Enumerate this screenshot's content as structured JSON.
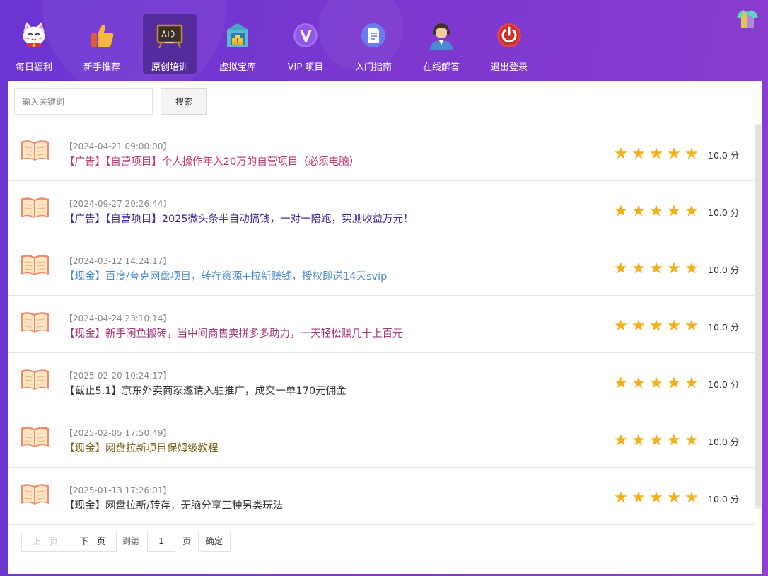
{
  "nav": {
    "items": [
      {
        "label": "每日福利",
        "icon": "lucky-cat-icon",
        "active": false
      },
      {
        "label": "新手推荐",
        "icon": "thumbs-up-icon",
        "active": false
      },
      {
        "label": "原创培训",
        "icon": "blackboard-icon",
        "active": true
      },
      {
        "label": "虚拟宝库",
        "icon": "vault-icon",
        "active": false
      },
      {
        "label": "VIP 项目",
        "icon": "vip-icon",
        "active": false
      },
      {
        "label": "入门指南",
        "icon": "document-icon",
        "active": false
      },
      {
        "label": "在线解答",
        "icon": "support-agent-icon",
        "active": false
      },
      {
        "label": "退出登录",
        "icon": "power-icon",
        "active": false
      }
    ],
    "skin_icon": "tshirt-icon"
  },
  "search": {
    "placeholder": "输入关键词",
    "value": "",
    "button_label": "搜索"
  },
  "items": [
    {
      "date": "【2024-04-21 09:00:00】",
      "title": "【广告】【自营项目】个人操作年入20万的自营项目（必须电脑）",
      "color": "#c0396f",
      "rating": 5,
      "score": "10.0 分"
    },
    {
      "date": "【2024-09-27 20:26:44】",
      "title": "【广告】【自营项目】2025微头条半自动搞钱，一对一陪跑，实测收益万元！",
      "color": "#3a2a98",
      "rating": 5,
      "score": "10.0 分"
    },
    {
      "date": "【2024-03-12 14:24:17】",
      "title": "【现金】百度/夸克网盘项目，转存资源+拉新赚钱，授权即送14天svip",
      "color": "#4a8ad0",
      "rating": 5,
      "score": "10.0 分"
    },
    {
      "date": "【2024-04-24 23:10:14】",
      "title": "【现金】新手闲鱼搬砖，当中间商售卖拼多多助力，一天轻松赚几十上百元",
      "color": "#a03a7a",
      "rating": 5,
      "score": "10.0 分"
    },
    {
      "date": "【2025-02-20 10:24:17】",
      "title": "【截止5.1】京东外卖商家邀请入驻推广，成交一单170元佣金",
      "color": "#333333",
      "rating": 5,
      "score": "10.0 分"
    },
    {
      "date": "【2025-02-05 17:50:49】",
      "title": "【现金】网盘拉新项目保姆级教程",
      "color": "#7a6420",
      "rating": 5,
      "score": "10.0 分"
    },
    {
      "date": "【2025-01-13 17:26:01】",
      "title": "【现金】网盘拉新/转存，无脑分享三种另类玩法",
      "color": "#333333",
      "rating": 5,
      "score": "10.0 分"
    }
  ],
  "pagination": {
    "prev_label": "上一页",
    "next_label": "下一页",
    "goto_label": "到第",
    "page_value": "1",
    "page_unit": "页",
    "confirm_label": "确定"
  },
  "colors": {
    "star": "#f2b01e",
    "book": "#ee8b6e"
  }
}
